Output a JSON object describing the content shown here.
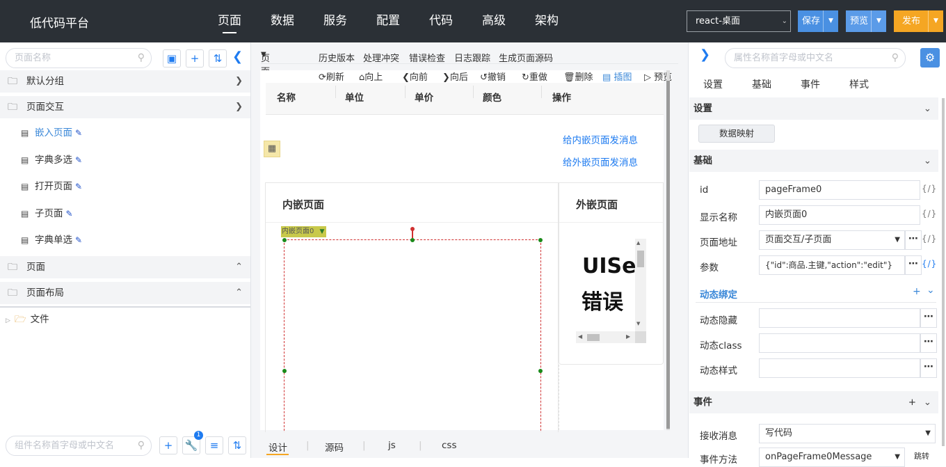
{
  "header": {
    "brand": "低代码平台",
    "nav": [
      "页面",
      "数据",
      "服务",
      "配置",
      "代码",
      "高级",
      "架构"
    ],
    "env_select": "react-桌面",
    "save_label": "保存",
    "preview_label": "预览",
    "publish_label": "发布",
    "colors": {
      "bg": "#2b3036",
      "save": "#4a90e2",
      "preview": "#5b9be8",
      "publish": "#f5a623"
    }
  },
  "left": {
    "search_placeholder": "页面名称",
    "groups": [
      {
        "label": "默认分组"
      },
      {
        "label": "页面交互"
      },
      {
        "label": "页面"
      },
      {
        "label": "页面布局"
      }
    ],
    "pages": [
      "嵌入页面",
      "字典多选",
      "打开页面",
      "子页面",
      "字典单选"
    ],
    "tree_label": "文件",
    "comp_search_placeholder": "组件名称首字母或中文名",
    "badge": "1"
  },
  "center": {
    "toolbar": [
      "页面结构",
      "历史版本",
      "处理冲突",
      "错误检查",
      "日志跟踪",
      "生成页面源码"
    ],
    "actions": [
      "刷新",
      "向上",
      "向前",
      "向后",
      "撤销",
      "重做",
      "删除",
      "插图",
      "预览"
    ],
    "table_headers": [
      "名称",
      "单位",
      "单价",
      "颜色",
      "操作"
    ],
    "links": [
      "给内嵌页面发消息",
      "给外嵌页面发消息"
    ],
    "panel_inner_title": "内嵌页面",
    "panel_outer_title": "外嵌页面",
    "frame_tag": "内嵌页面0",
    "outer_text_1": "UISe",
    "outer_text_2": "错误",
    "bottom_tabs": [
      "设计",
      "源码",
      "js",
      "css"
    ]
  },
  "right": {
    "search_placeholder": "属性名称首字母或中文名",
    "tabs": [
      "设置",
      "基础",
      "事件",
      "样式"
    ],
    "sec_settings": "设置",
    "data_map_btn": "数据映射",
    "sec_basic": "基础",
    "props": [
      {
        "label": "id",
        "value": "pageFrame0",
        "code": "{/}"
      },
      {
        "label": "显示名称",
        "value": "内嵌页面0",
        "code": "{/}"
      },
      {
        "label": "页面地址",
        "value": "页面交互/子页面",
        "code": "{/}"
      },
      {
        "label": "参数",
        "value": "{\"id\":商品.主键,\"action\":\"edit\"}",
        "code": "{/}"
      }
    ],
    "dyn_bind": "动态绑定",
    "dyn_props": [
      {
        "label": "动态隐藏",
        "value": ""
      },
      {
        "label": "动态class",
        "value": ""
      },
      {
        "label": "动态样式",
        "value": ""
      }
    ],
    "sec_event": "事件",
    "event_props": [
      {
        "label": "接收消息",
        "value": "写代码"
      },
      {
        "label": "事件方法",
        "value": "onPageFrame0Message",
        "extra": "跳转"
      }
    ]
  }
}
